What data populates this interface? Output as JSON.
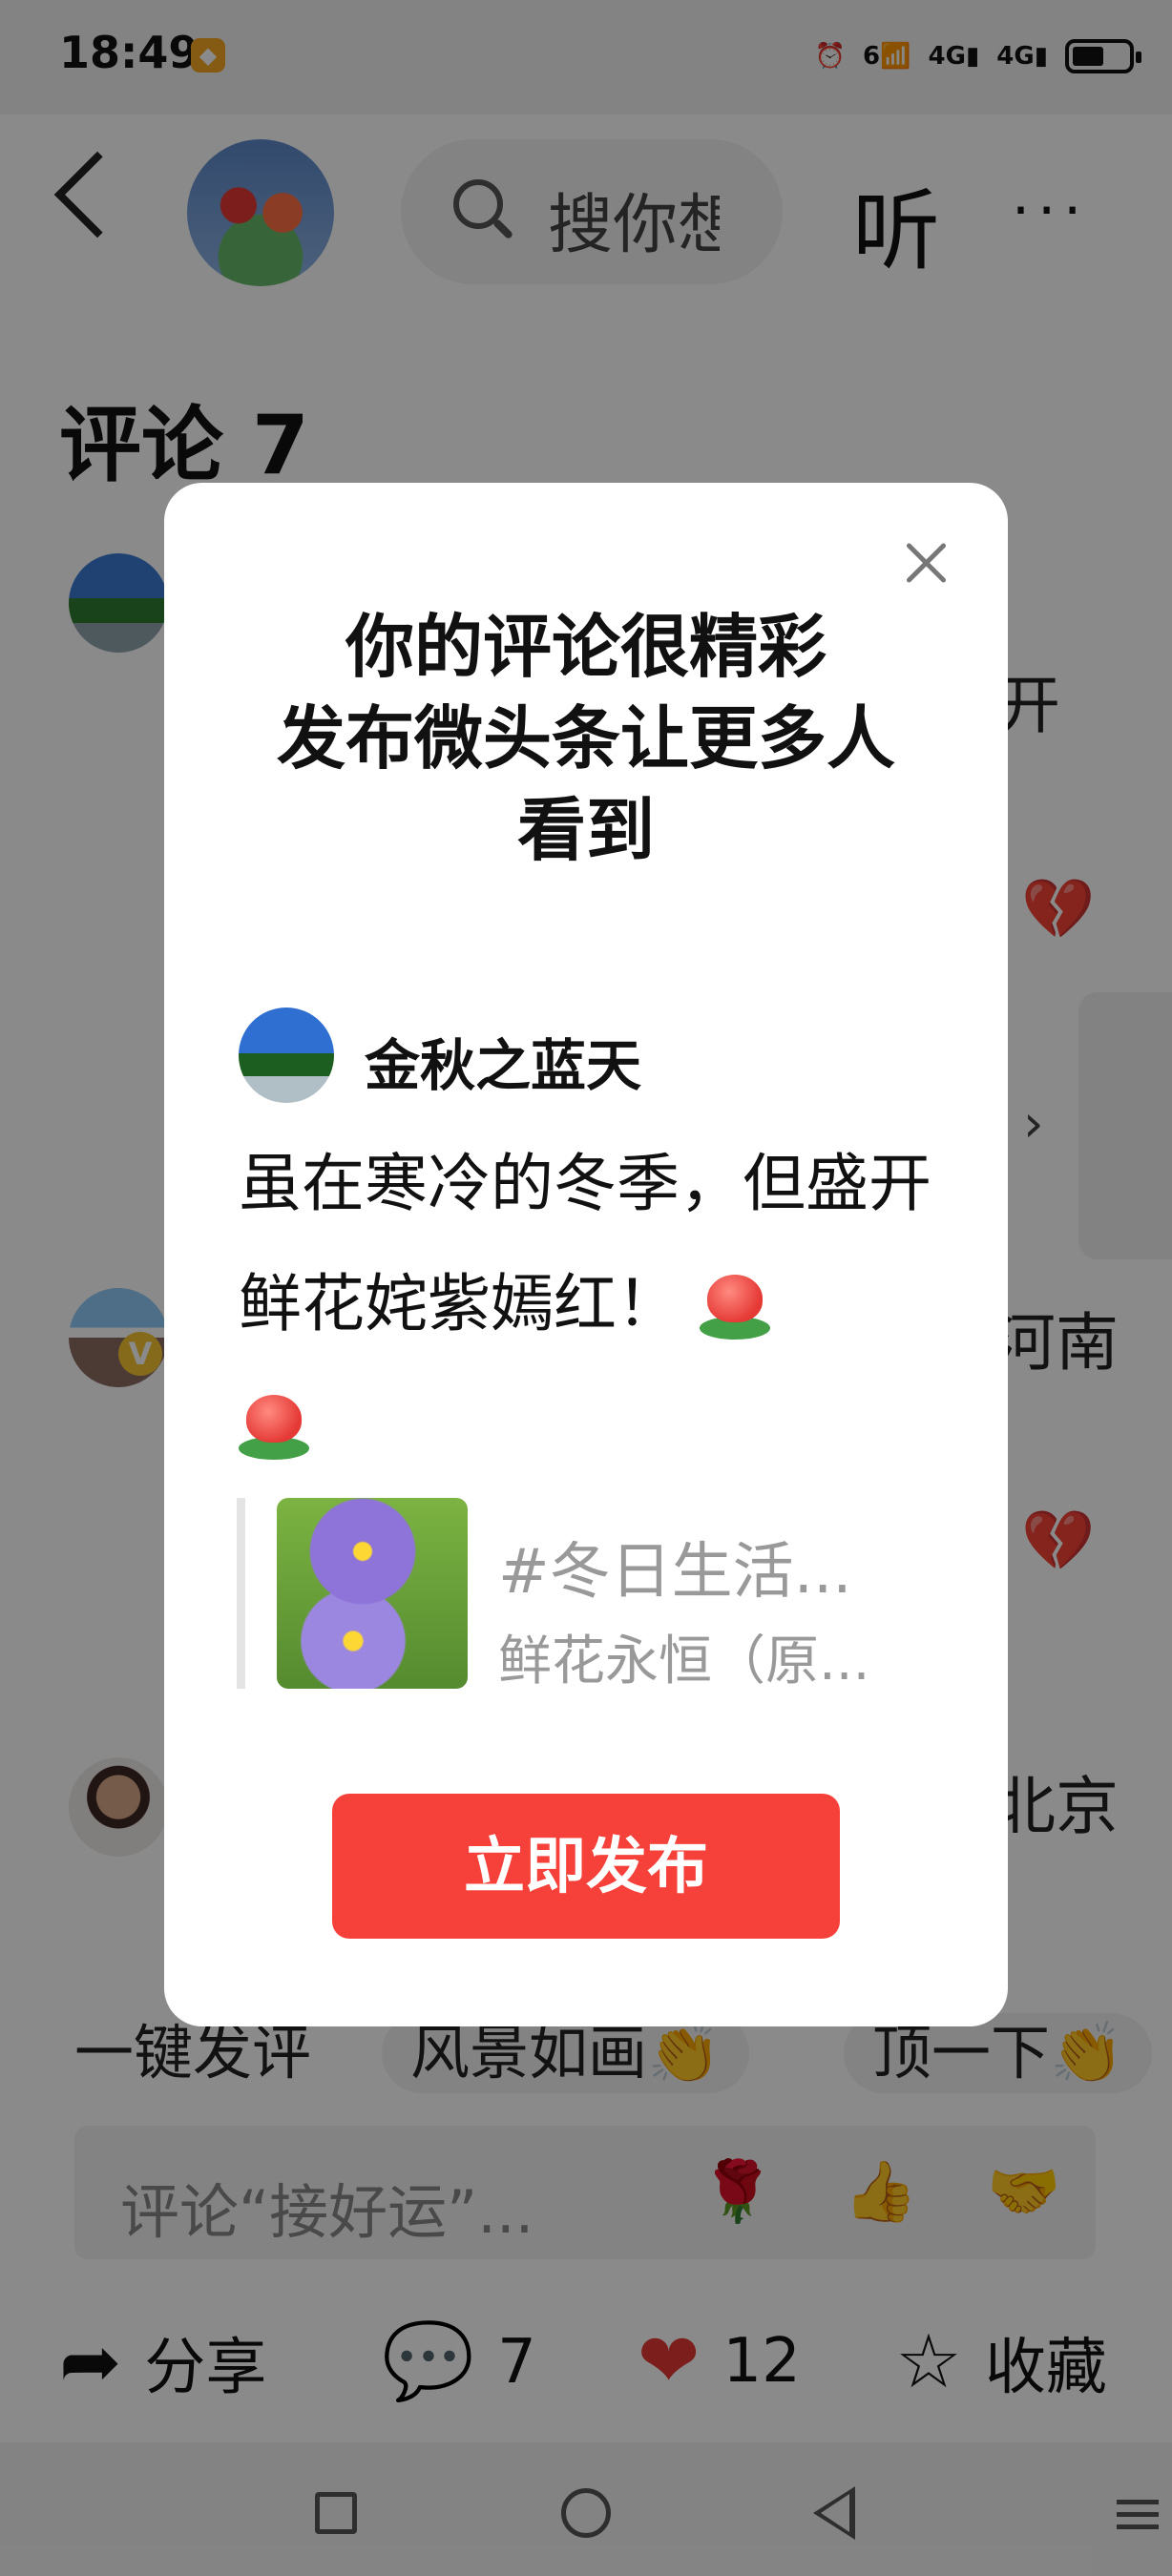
{
  "status_bar": {
    "time": "18:49",
    "network_1": "6",
    "network_2": "4G",
    "network_3": "4G"
  },
  "header": {
    "search_placeholder": "搜你想",
    "listen_label": "听",
    "more_label": "···"
  },
  "comments": {
    "title": "评论 7",
    "side_fragments": [
      "开",
      "河南",
      "北京"
    ]
  },
  "quick_replies": [
    "一键发评",
    "风景如画👏",
    "顶一下👏"
  ],
  "comment_input": {
    "placeholder": "评论“接好运”...",
    "emojis": [
      "🌹",
      "👍",
      "🤝"
    ]
  },
  "actions": {
    "share_label": "分享",
    "comment_count": "7",
    "like_count": "12",
    "favorite_label": "收藏"
  },
  "modal": {
    "title_line1": "你的评论很精彩",
    "title_line2": "发布微头条让更多人",
    "title_line3": "看到",
    "user_name": "金秋之蓝天",
    "comment_text": "虽在寒冷的冬季，但盛开鲜花姹紫嫣红！",
    "quoted_title": "#冬日生活...",
    "quoted_subtitle": "鲜花永恒（原...",
    "publish_label": "立即发布"
  }
}
